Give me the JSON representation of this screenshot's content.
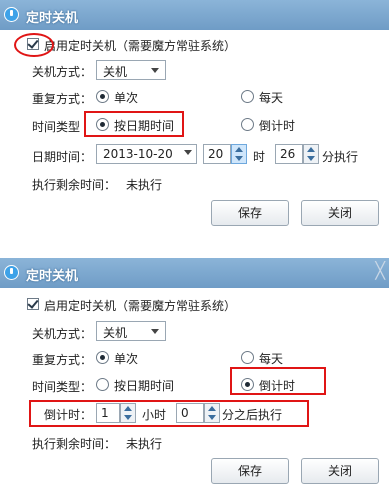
{
  "top": {
    "title": "定时关机",
    "enable_label": "启用定时关机（需要魔方常驻系统）",
    "shutdown_mode_label": "关机方式：",
    "shutdown_mode_value": "关机",
    "repeat_label": "重复方式：",
    "repeat_once": "单次",
    "repeat_daily": "每天",
    "time_type_label": "时间类型",
    "by_date": "按日期时间",
    "countdown": "倒计时",
    "datetime_label": "日期时间：",
    "date_value": "2013-10-20",
    "hour_value": "20",
    "hour_unit": "时",
    "minute_value": "26",
    "minute_suffix": "分执行",
    "remaining_label": "执行剩余时间：",
    "remaining_value": "未执行",
    "save": "保存",
    "close": "关闭"
  },
  "bottom": {
    "title": "定时关机",
    "close_glyph": "╳",
    "enable_label": "启用定时关机（需要魔方常驻系统）",
    "shutdown_mode_label": "关机方式：",
    "shutdown_mode_value": "关机",
    "repeat_label": "重复方式：",
    "repeat_once": "单次",
    "repeat_daily": "每天",
    "time_type_label": "时间类型：",
    "by_date": "按日期时间",
    "countdown": "倒计时",
    "countdown_label": "倒计时：",
    "hours_value": "1",
    "hours_unit": "小时",
    "minutes_value": "0",
    "minutes_suffix": "分之后执行",
    "remaining_label": "执行剩余时间：",
    "remaining_value": "未执行",
    "save": "保存",
    "close": "关闭"
  }
}
